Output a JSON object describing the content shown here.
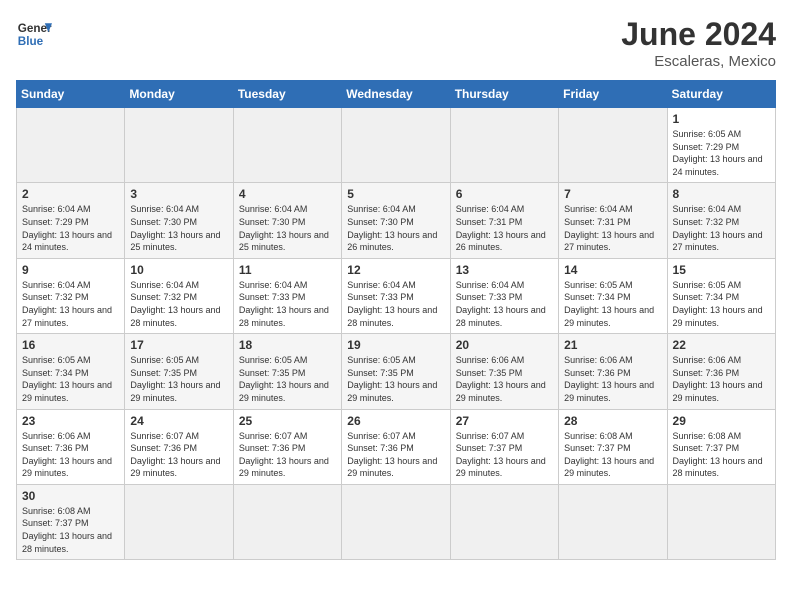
{
  "header": {
    "logo_general": "General",
    "logo_blue": "Blue",
    "title": "June 2024",
    "subtitle": "Escaleras, Mexico"
  },
  "weekdays": [
    "Sunday",
    "Monday",
    "Tuesday",
    "Wednesday",
    "Thursday",
    "Friday",
    "Saturday"
  ],
  "weeks": [
    [
      {
        "day": "",
        "info": ""
      },
      {
        "day": "",
        "info": ""
      },
      {
        "day": "",
        "info": ""
      },
      {
        "day": "",
        "info": ""
      },
      {
        "day": "",
        "info": ""
      },
      {
        "day": "",
        "info": ""
      },
      {
        "day": "1",
        "info": "Sunrise: 6:05 AM\nSunset: 7:29 PM\nDaylight: 13 hours and 24 minutes."
      }
    ],
    [
      {
        "day": "2",
        "info": "Sunrise: 6:04 AM\nSunset: 7:29 PM\nDaylight: 13 hours and 24 minutes."
      },
      {
        "day": "3",
        "info": "Sunrise: 6:04 AM\nSunset: 7:30 PM\nDaylight: 13 hours and 25 minutes."
      },
      {
        "day": "4",
        "info": "Sunrise: 6:04 AM\nSunset: 7:30 PM\nDaylight: 13 hours and 25 minutes."
      },
      {
        "day": "5",
        "info": "Sunrise: 6:04 AM\nSunset: 7:30 PM\nDaylight: 13 hours and 26 minutes."
      },
      {
        "day": "6",
        "info": "Sunrise: 6:04 AM\nSunset: 7:31 PM\nDaylight: 13 hours and 26 minutes."
      },
      {
        "day": "7",
        "info": "Sunrise: 6:04 AM\nSunset: 7:31 PM\nDaylight: 13 hours and 27 minutes."
      },
      {
        "day": "8",
        "info": "Sunrise: 6:04 AM\nSunset: 7:32 PM\nDaylight: 13 hours and 27 minutes."
      }
    ],
    [
      {
        "day": "9",
        "info": "Sunrise: 6:04 AM\nSunset: 7:32 PM\nDaylight: 13 hours and 27 minutes."
      },
      {
        "day": "10",
        "info": "Sunrise: 6:04 AM\nSunset: 7:32 PM\nDaylight: 13 hours and 28 minutes."
      },
      {
        "day": "11",
        "info": "Sunrise: 6:04 AM\nSunset: 7:33 PM\nDaylight: 13 hours and 28 minutes."
      },
      {
        "day": "12",
        "info": "Sunrise: 6:04 AM\nSunset: 7:33 PM\nDaylight: 13 hours and 28 minutes."
      },
      {
        "day": "13",
        "info": "Sunrise: 6:04 AM\nSunset: 7:33 PM\nDaylight: 13 hours and 28 minutes."
      },
      {
        "day": "14",
        "info": "Sunrise: 6:05 AM\nSunset: 7:34 PM\nDaylight: 13 hours and 29 minutes."
      },
      {
        "day": "15",
        "info": "Sunrise: 6:05 AM\nSunset: 7:34 PM\nDaylight: 13 hours and 29 minutes."
      }
    ],
    [
      {
        "day": "16",
        "info": "Sunrise: 6:05 AM\nSunset: 7:34 PM\nDaylight: 13 hours and 29 minutes."
      },
      {
        "day": "17",
        "info": "Sunrise: 6:05 AM\nSunset: 7:35 PM\nDaylight: 13 hours and 29 minutes."
      },
      {
        "day": "18",
        "info": "Sunrise: 6:05 AM\nSunset: 7:35 PM\nDaylight: 13 hours and 29 minutes."
      },
      {
        "day": "19",
        "info": "Sunrise: 6:05 AM\nSunset: 7:35 PM\nDaylight: 13 hours and 29 minutes."
      },
      {
        "day": "20",
        "info": "Sunrise: 6:06 AM\nSunset: 7:35 PM\nDaylight: 13 hours and 29 minutes."
      },
      {
        "day": "21",
        "info": "Sunrise: 6:06 AM\nSunset: 7:36 PM\nDaylight: 13 hours and 29 minutes."
      },
      {
        "day": "22",
        "info": "Sunrise: 6:06 AM\nSunset: 7:36 PM\nDaylight: 13 hours and 29 minutes."
      }
    ],
    [
      {
        "day": "23",
        "info": "Sunrise: 6:06 AM\nSunset: 7:36 PM\nDaylight: 13 hours and 29 minutes."
      },
      {
        "day": "24",
        "info": "Sunrise: 6:07 AM\nSunset: 7:36 PM\nDaylight: 13 hours and 29 minutes."
      },
      {
        "day": "25",
        "info": "Sunrise: 6:07 AM\nSunset: 7:36 PM\nDaylight: 13 hours and 29 minutes."
      },
      {
        "day": "26",
        "info": "Sunrise: 6:07 AM\nSunset: 7:36 PM\nDaylight: 13 hours and 29 minutes."
      },
      {
        "day": "27",
        "info": "Sunrise: 6:07 AM\nSunset: 7:37 PM\nDaylight: 13 hours and 29 minutes."
      },
      {
        "day": "28",
        "info": "Sunrise: 6:08 AM\nSunset: 7:37 PM\nDaylight: 13 hours and 29 minutes."
      },
      {
        "day": "29",
        "info": "Sunrise: 6:08 AM\nSunset: 7:37 PM\nDaylight: 13 hours and 28 minutes."
      }
    ],
    [
      {
        "day": "30",
        "info": "Sunrise: 6:08 AM\nSunset: 7:37 PM\nDaylight: 13 hours and 28 minutes."
      },
      {
        "day": "",
        "info": ""
      },
      {
        "day": "",
        "info": ""
      },
      {
        "day": "",
        "info": ""
      },
      {
        "day": "",
        "info": ""
      },
      {
        "day": "",
        "info": ""
      },
      {
        "day": "",
        "info": ""
      }
    ]
  ]
}
